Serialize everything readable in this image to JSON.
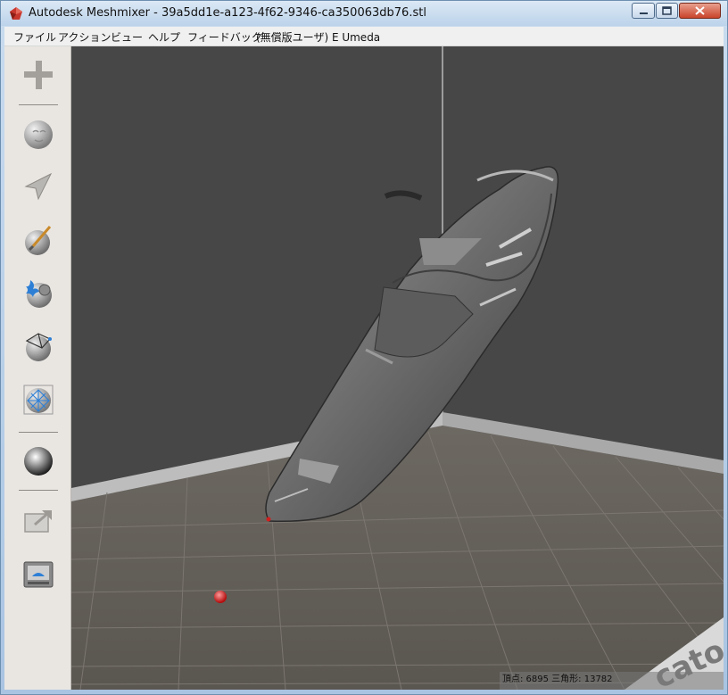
{
  "window": {
    "title": "Autodesk Meshmixer - 39a5dd1e-a123-4f62-9346-ca350063db76.stl"
  },
  "menu": {
    "items": [
      "ファイル",
      "アクション",
      "ビュー",
      "ヘルプ",
      "フィードバック",
      "(無償版ユーザ) E Umeda"
    ]
  },
  "toolbar": {
    "tools": [
      {
        "icon": "plus-icon"
      },
      {
        "icon": "meshmix-icon"
      },
      {
        "icon": "select-arrow-icon"
      },
      {
        "icon": "sculpt-brush-icon"
      },
      {
        "icon": "stamp-icon"
      },
      {
        "icon": "edit-icon"
      },
      {
        "icon": "analysis-icon"
      },
      {
        "icon": "shaders-icon"
      },
      {
        "icon": "export-icon"
      },
      {
        "icon": "print-icon"
      }
    ]
  },
  "status": {
    "text": "頂点: 6895 三角形: 13782"
  },
  "colors": {
    "viewport_back": "#474747",
    "floor": "#67625c",
    "model": "#6b6b6b",
    "accent_red": "#d21e1e"
  }
}
